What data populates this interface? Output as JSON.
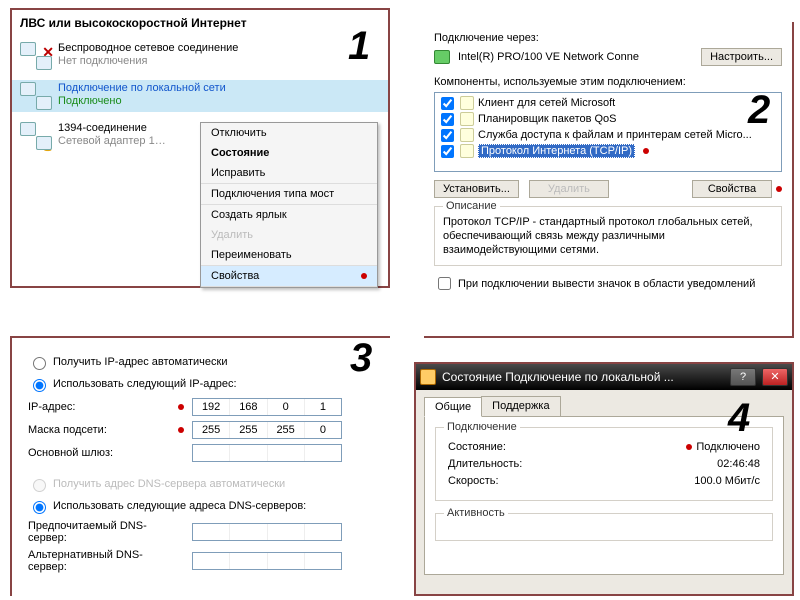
{
  "numbers": {
    "n1": "1",
    "n2": "2",
    "n3": "3",
    "n4": "4"
  },
  "panel1": {
    "title": "ЛВС или высокоскоростной Интернет",
    "connections": [
      {
        "name": "Беспроводное сетевое соединение",
        "status": "Нет подключения",
        "status_class": "off",
        "x": true
      },
      {
        "name": "Подключение по локальной сети",
        "status": "Подключено",
        "status_class": "on",
        "selected": true
      },
      {
        "name": "1394-соединение",
        "status": "Сетевой адаптер 1…",
        "status_class": "off",
        "lock": true
      }
    ],
    "menu": {
      "disable": "Отключить",
      "status": "Состояние",
      "repair": "Исправить",
      "bridge": "Подключения типа мост",
      "shortcut": "Создать ярлык",
      "delete": "Удалить",
      "rename": "Переименовать",
      "properties": "Свойства"
    }
  },
  "panel2": {
    "connect_via": "Подключение через:",
    "nic": "Intel(R) PRO/100 VE Network Conne",
    "configure": "Настроить...",
    "components_label": "Компоненты, используемые этим подключением:",
    "components": [
      {
        "label": "Клиент для сетей Microsoft",
        "checked": true
      },
      {
        "label": "Планировщик пакетов QoS",
        "checked": true
      },
      {
        "label": "Служба доступа к файлам и принтерам сетей Micro...",
        "checked": true
      },
      {
        "label": "Протокол Интернета (TCP/IP)",
        "checked": true,
        "selected": true
      }
    ],
    "install": "Установить...",
    "uninstall": "Удалить",
    "properties": "Свойства",
    "description_label": "Описание",
    "description": "Протокол TCP/IP - стандартный протокол глобальных сетей, обеспечивающий связь между различными взаимодействующими сетями.",
    "tray_icon": "При подключении вывести значок в области уведомлений"
  },
  "panel3": {
    "auto_ip": "Получить IP-адрес автоматически",
    "manual_ip": "Использовать следующий IP-адрес:",
    "ip_label": "IP-адрес:",
    "ip_value": [
      "192",
      "168",
      "0",
      "1"
    ],
    "mask_label": "Маска подсети:",
    "mask_value": [
      "255",
      "255",
      "255",
      "0"
    ],
    "gateway_label": "Основной шлюз:",
    "auto_dns": "Получить адрес DNS-сервера автоматически",
    "manual_dns": "Использовать следующие адреса DNS-серверов:",
    "dns1_label": "Предпочитаемый DNS-сервер:",
    "dns2_label": "Альтернативный DNS-сервер:"
  },
  "panel4": {
    "title": "Состояние Подключение по локальной ...",
    "tab_general": "Общие",
    "tab_support": "Поддержка",
    "group_conn": "Подключение",
    "status_label": "Состояние:",
    "status_value": "Подключено",
    "duration_label": "Длительность:",
    "duration_value": "02:46:48",
    "speed_label": "Скорость:",
    "speed_value": "100.0 Мбит/с",
    "group_activity": "Активность"
  }
}
